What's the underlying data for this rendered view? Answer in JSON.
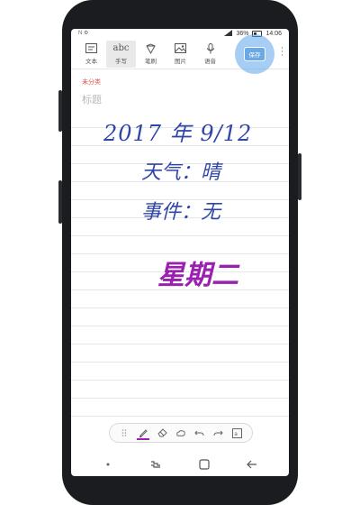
{
  "status": {
    "battery": "36%",
    "time": "14:06",
    "left_icons": "N ⚙"
  },
  "toolbar": {
    "items": [
      {
        "label": "文本",
        "icon": "text-box-icon"
      },
      {
        "label": "手写",
        "icon": "abc-handwriting-icon",
        "icon_text": "abc"
      },
      {
        "label": "笔刷",
        "icon": "brush-icon"
      },
      {
        "label": "图片",
        "icon": "image-icon"
      },
      {
        "label": "语音",
        "icon": "microphone-icon"
      }
    ],
    "save_label": "保存"
  },
  "note": {
    "category": "未分类",
    "title_placeholder": "标题",
    "handwriting": {
      "date": "2017 年 9/12",
      "weather": "天气：晴",
      "event": "事件：无",
      "day": "星期二"
    }
  },
  "colors": {
    "ink_blue": "#2f45a8",
    "ink_purple": "#9b1fb0",
    "category_red": "#d9534f",
    "save_highlight": "#5da5ec"
  },
  "pen_tools": [
    "drag-handle-icon",
    "pen-icon",
    "eraser-icon",
    "lasso-icon",
    "undo-icon",
    "redo-icon",
    "convert-text-icon"
  ],
  "navbar": [
    "menu-dot-icon",
    "recent-apps-icon",
    "home-icon",
    "back-icon"
  ]
}
